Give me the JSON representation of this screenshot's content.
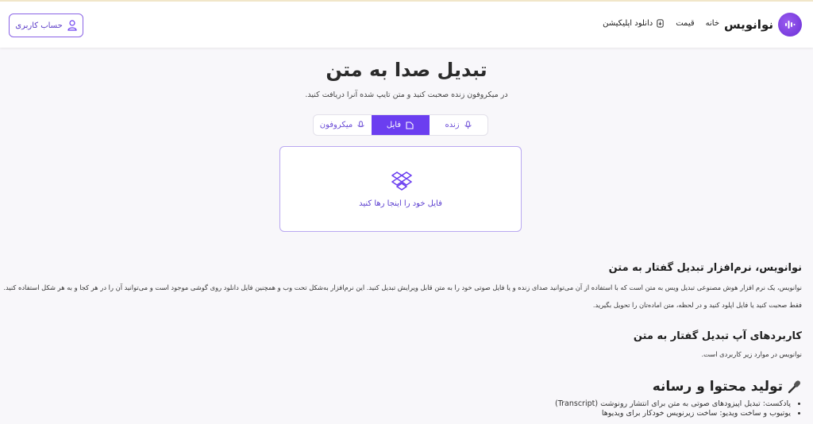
{
  "header": {
    "brand": "نوانویس",
    "nav": [
      "خانه",
      "قیمت",
      "دانلود اپلیکیشن"
    ],
    "account_button": "حساب کاربری"
  },
  "hero": {
    "title": "تبدیل صدا به متن",
    "subtitle": "در میکروفون زنده صحبت کنید و متن تایپ شده آنرا دریافت کنید.",
    "tabs": [
      "زنده",
      "فایل",
      "میکروفون"
    ],
    "active_tab": "فایل",
    "dropzone_text": "فایل خود را اینجا رها کنید"
  },
  "content": {
    "intro_heading": "نوانویس، نرم‌افزار تبدیل گفتار به متن",
    "intro_para_1": "نوانویس، یک نرم افزار هوش مصنوعی تبدیل ویس به متن است که با استفاده از آن می‌توانید صدای زنده و یا فایل صوتی خود را به متن قابل ویرایش تبدیل کنید. این نرم‌افزار به‌شکل تحت وب و همچنین فایل دانلود روی گوشی موجود است و می‌توانید آن را در هر کجا و به هر شکل استفاده کنید.",
    "intro_para_2": "فقط صحبت کنید یا فایل اپلود کنید و در لحظه، متن اماده‌تان را تحویل بگیرید.",
    "uses_heading": "کاربردهای آپ تبدیل گفتار به متن",
    "uses_para": "نوانویس در موارد زیر کاربردی است.",
    "section_heading": "تولید محتوا و رسانه",
    "bullets": [
      "پادکست: تبدیل اپیزودهای صوتی به متن برای انتشار رونوشت (Transcript)",
      "یوتیوب و ساخت ویدیو: ساخت زیرنویس خودکار برای ویدیوها"
    ]
  },
  "colors": {
    "accent": "#6b3ef0",
    "accent_text": "#5c3fd0",
    "background": "#f8f7fa"
  },
  "icons": [
    "logo-sound-icon",
    "download-app-icon",
    "user-icon",
    "live-mic-icon",
    "file-icon",
    "microphone-icon",
    "dropbox-icon",
    "microphone-emoji-icon"
  ]
}
